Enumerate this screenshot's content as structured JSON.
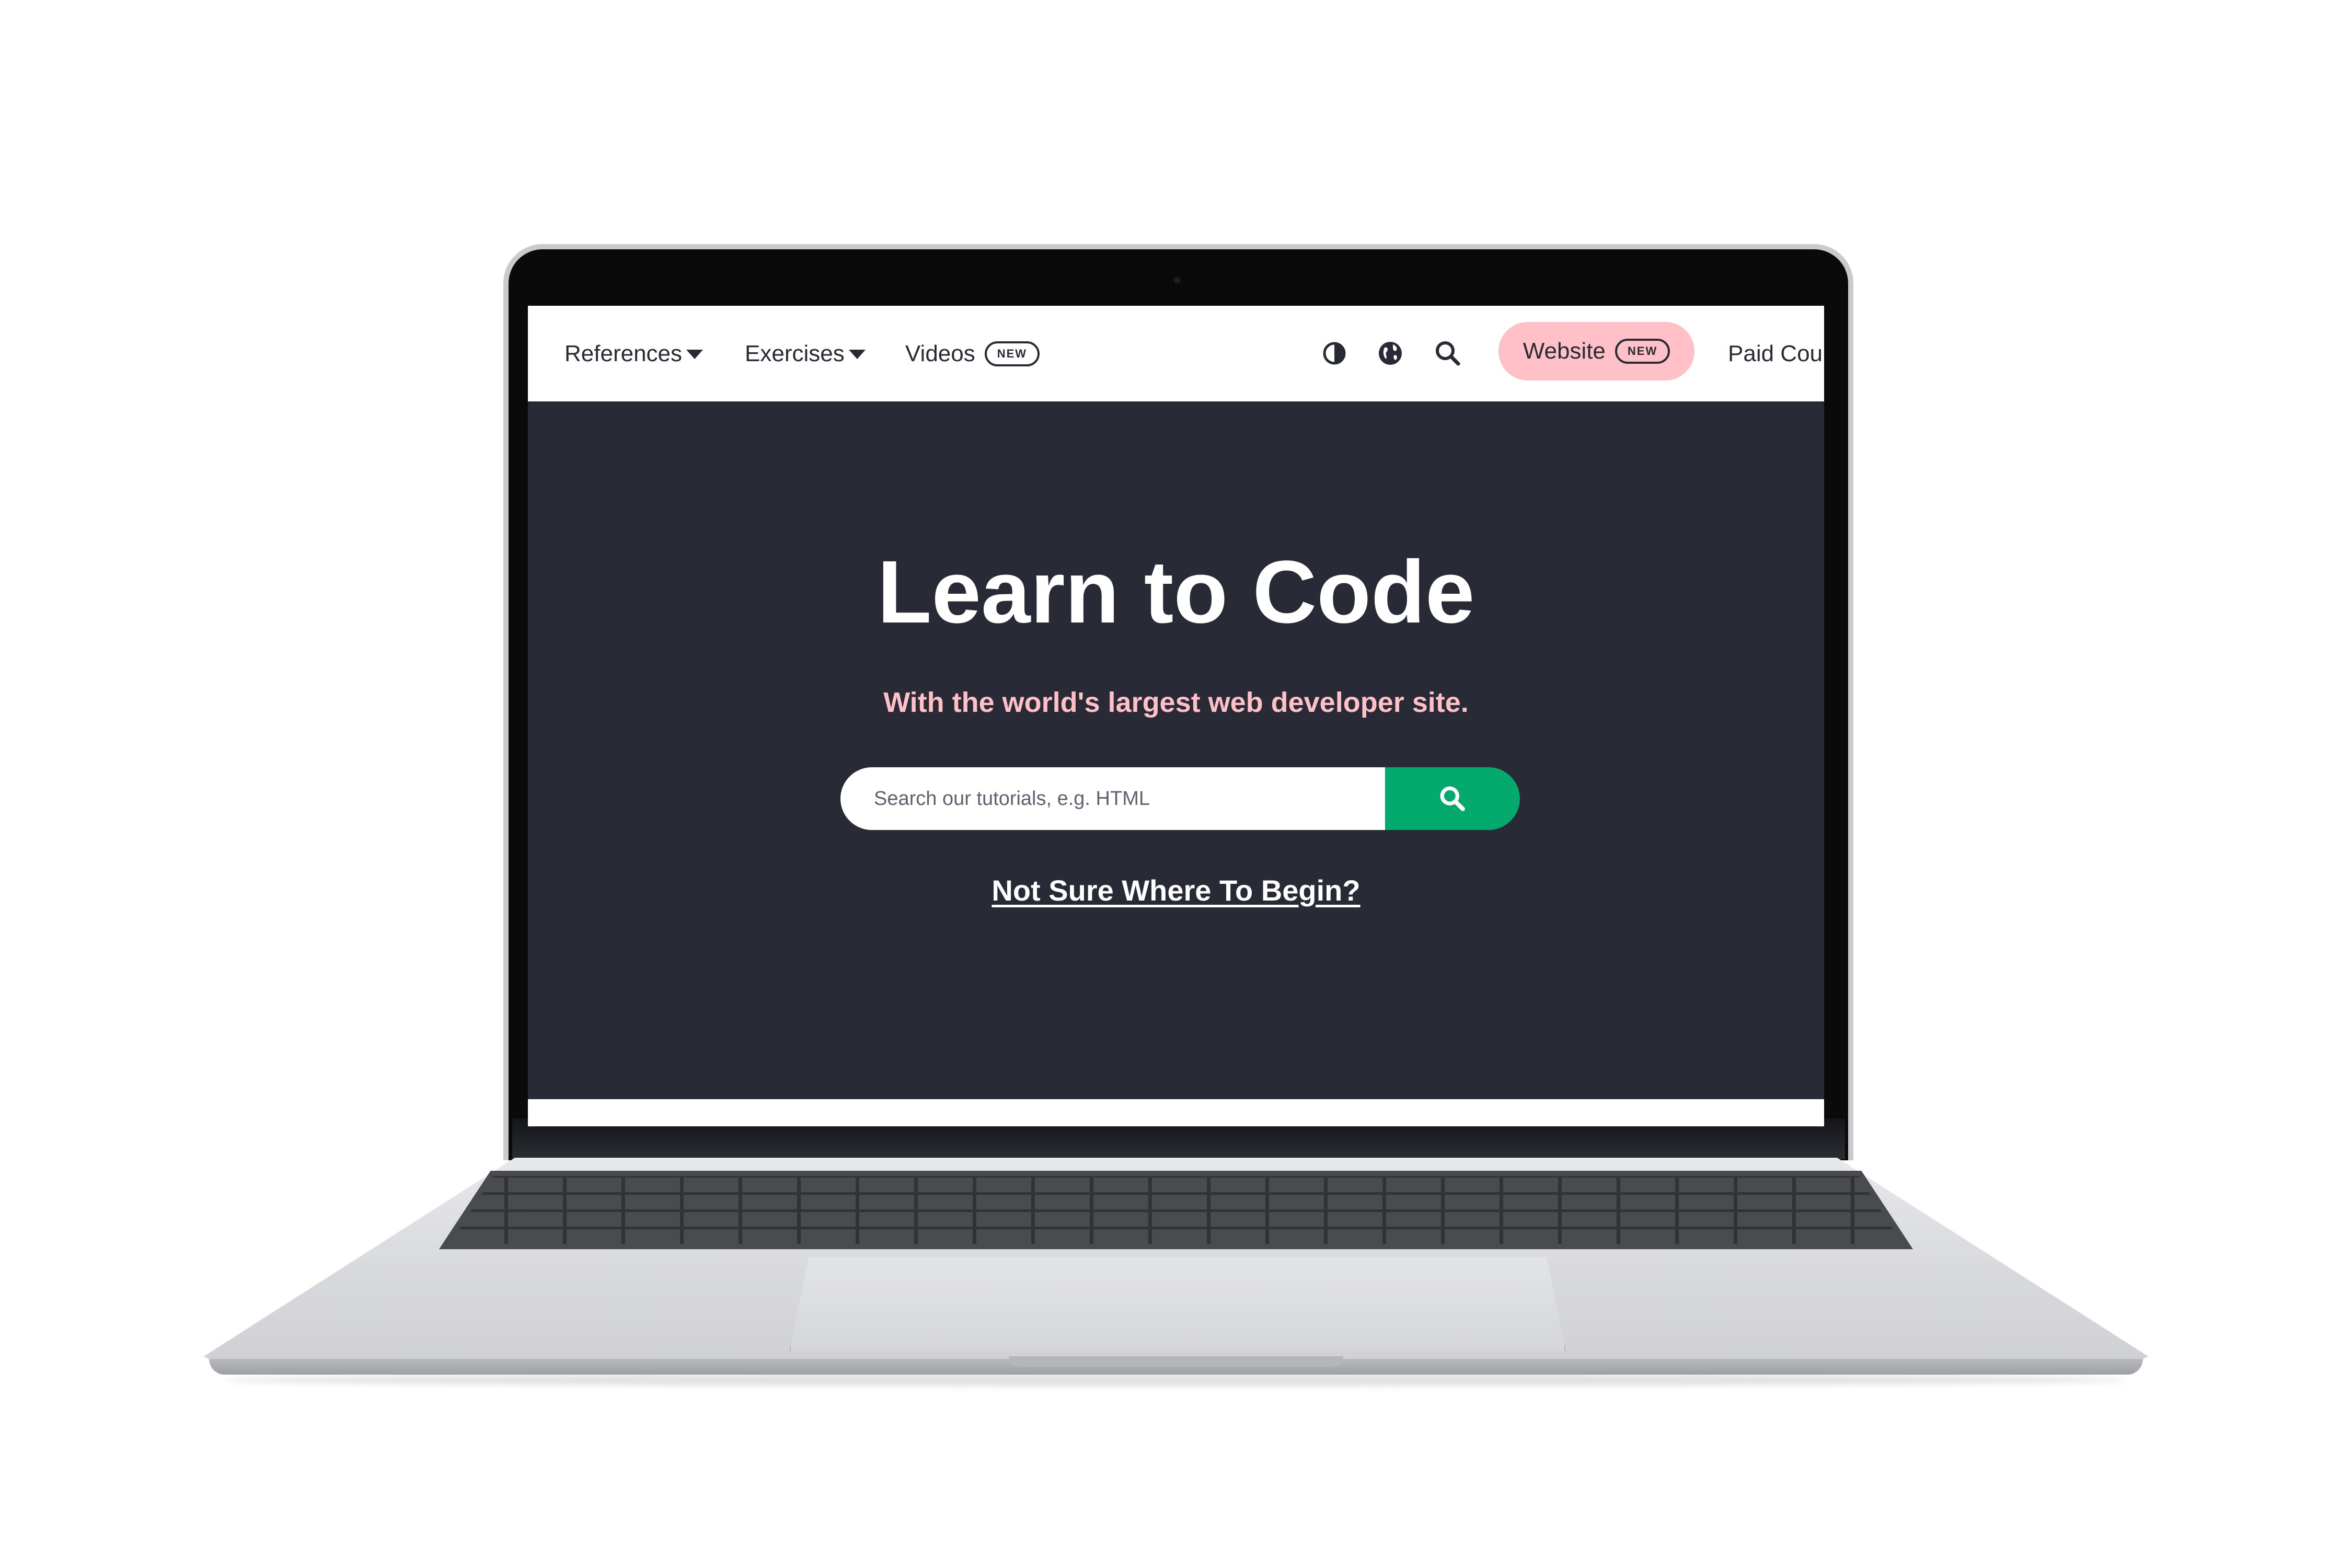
{
  "navbar": {
    "references_label": "References",
    "exercises_label": "Exercises",
    "videos_label": "Videos",
    "videos_badge": "NEW",
    "website_label": "Website",
    "website_badge": "NEW",
    "paid_courses_label": "Paid Cour"
  },
  "hero": {
    "title": "Learn to Code",
    "subtitle": "With the world's largest web developer site.",
    "search_placeholder": "Search our tutorials, e.g. HTML",
    "begin_link": "Not Sure Where To Begin?"
  },
  "icons": {
    "theme_toggle": "contrast-icon",
    "language": "globe-icon",
    "search": "search-icon",
    "search_submit": "search-icon"
  },
  "colors": {
    "hero_bg": "#282a35",
    "accent_pink": "#ffc0c7",
    "search_green": "#04aa6d",
    "nav_text": "#282a35"
  }
}
